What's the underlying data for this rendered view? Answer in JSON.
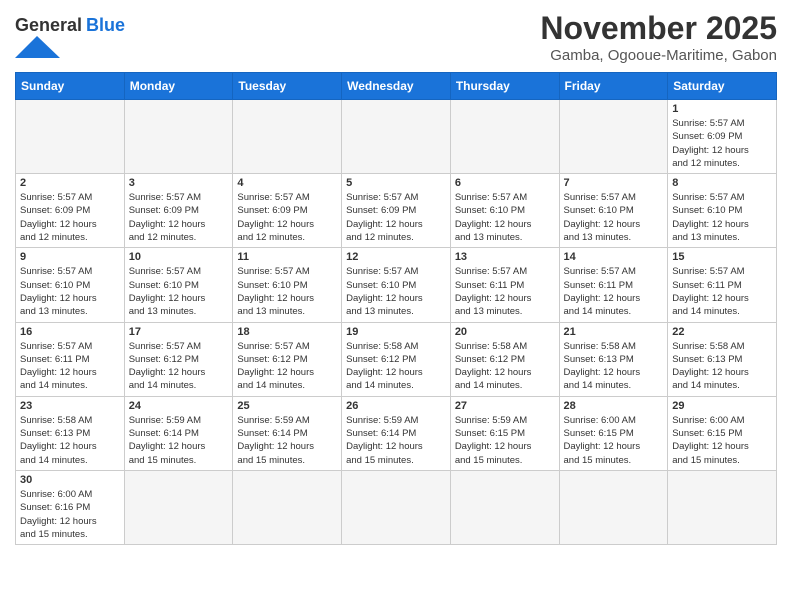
{
  "header": {
    "logo_general": "General",
    "logo_blue": "Blue",
    "month": "November 2025",
    "location": "Gamba, Ogooue-Maritime, Gabon"
  },
  "weekdays": [
    "Sunday",
    "Monday",
    "Tuesday",
    "Wednesday",
    "Thursday",
    "Friday",
    "Saturday"
  ],
  "days": [
    {
      "num": "",
      "empty": true,
      "info": ""
    },
    {
      "num": "",
      "empty": true,
      "info": ""
    },
    {
      "num": "",
      "empty": true,
      "info": ""
    },
    {
      "num": "",
      "empty": true,
      "info": ""
    },
    {
      "num": "",
      "empty": true,
      "info": ""
    },
    {
      "num": "",
      "empty": true,
      "info": ""
    },
    {
      "num": "1",
      "empty": false,
      "info": "Sunrise: 5:57 AM\nSunset: 6:09 PM\nDaylight: 12 hours\nand 12 minutes."
    },
    {
      "num": "2",
      "empty": false,
      "info": "Sunrise: 5:57 AM\nSunset: 6:09 PM\nDaylight: 12 hours\nand 12 minutes."
    },
    {
      "num": "3",
      "empty": false,
      "info": "Sunrise: 5:57 AM\nSunset: 6:09 PM\nDaylight: 12 hours\nand 12 minutes."
    },
    {
      "num": "4",
      "empty": false,
      "info": "Sunrise: 5:57 AM\nSunset: 6:09 PM\nDaylight: 12 hours\nand 12 minutes."
    },
    {
      "num": "5",
      "empty": false,
      "info": "Sunrise: 5:57 AM\nSunset: 6:09 PM\nDaylight: 12 hours\nand 12 minutes."
    },
    {
      "num": "6",
      "empty": false,
      "info": "Sunrise: 5:57 AM\nSunset: 6:10 PM\nDaylight: 12 hours\nand 13 minutes."
    },
    {
      "num": "7",
      "empty": false,
      "info": "Sunrise: 5:57 AM\nSunset: 6:10 PM\nDaylight: 12 hours\nand 13 minutes."
    },
    {
      "num": "8",
      "empty": false,
      "info": "Sunrise: 5:57 AM\nSunset: 6:10 PM\nDaylight: 12 hours\nand 13 minutes."
    },
    {
      "num": "9",
      "empty": false,
      "info": "Sunrise: 5:57 AM\nSunset: 6:10 PM\nDaylight: 12 hours\nand 13 minutes."
    },
    {
      "num": "10",
      "empty": false,
      "info": "Sunrise: 5:57 AM\nSunset: 6:10 PM\nDaylight: 12 hours\nand 13 minutes."
    },
    {
      "num": "11",
      "empty": false,
      "info": "Sunrise: 5:57 AM\nSunset: 6:10 PM\nDaylight: 12 hours\nand 13 minutes."
    },
    {
      "num": "12",
      "empty": false,
      "info": "Sunrise: 5:57 AM\nSunset: 6:10 PM\nDaylight: 12 hours\nand 13 minutes."
    },
    {
      "num": "13",
      "empty": false,
      "info": "Sunrise: 5:57 AM\nSunset: 6:11 PM\nDaylight: 12 hours\nand 13 minutes."
    },
    {
      "num": "14",
      "empty": false,
      "info": "Sunrise: 5:57 AM\nSunset: 6:11 PM\nDaylight: 12 hours\nand 14 minutes."
    },
    {
      "num": "15",
      "empty": false,
      "info": "Sunrise: 5:57 AM\nSunset: 6:11 PM\nDaylight: 12 hours\nand 14 minutes."
    },
    {
      "num": "16",
      "empty": false,
      "info": "Sunrise: 5:57 AM\nSunset: 6:11 PM\nDaylight: 12 hours\nand 14 minutes."
    },
    {
      "num": "17",
      "empty": false,
      "info": "Sunrise: 5:57 AM\nSunset: 6:12 PM\nDaylight: 12 hours\nand 14 minutes."
    },
    {
      "num": "18",
      "empty": false,
      "info": "Sunrise: 5:57 AM\nSunset: 6:12 PM\nDaylight: 12 hours\nand 14 minutes."
    },
    {
      "num": "19",
      "empty": false,
      "info": "Sunrise: 5:58 AM\nSunset: 6:12 PM\nDaylight: 12 hours\nand 14 minutes."
    },
    {
      "num": "20",
      "empty": false,
      "info": "Sunrise: 5:58 AM\nSunset: 6:12 PM\nDaylight: 12 hours\nand 14 minutes."
    },
    {
      "num": "21",
      "empty": false,
      "info": "Sunrise: 5:58 AM\nSunset: 6:13 PM\nDaylight: 12 hours\nand 14 minutes."
    },
    {
      "num": "22",
      "empty": false,
      "info": "Sunrise: 5:58 AM\nSunset: 6:13 PM\nDaylight: 12 hours\nand 14 minutes."
    },
    {
      "num": "23",
      "empty": false,
      "info": "Sunrise: 5:58 AM\nSunset: 6:13 PM\nDaylight: 12 hours\nand 14 minutes."
    },
    {
      "num": "24",
      "empty": false,
      "info": "Sunrise: 5:59 AM\nSunset: 6:14 PM\nDaylight: 12 hours\nand 15 minutes."
    },
    {
      "num": "25",
      "empty": false,
      "info": "Sunrise: 5:59 AM\nSunset: 6:14 PM\nDaylight: 12 hours\nand 15 minutes."
    },
    {
      "num": "26",
      "empty": false,
      "info": "Sunrise: 5:59 AM\nSunset: 6:14 PM\nDaylight: 12 hours\nand 15 minutes."
    },
    {
      "num": "27",
      "empty": false,
      "info": "Sunrise: 5:59 AM\nSunset: 6:15 PM\nDaylight: 12 hours\nand 15 minutes."
    },
    {
      "num": "28",
      "empty": false,
      "info": "Sunrise: 6:00 AM\nSunset: 6:15 PM\nDaylight: 12 hours\nand 15 minutes."
    },
    {
      "num": "29",
      "empty": false,
      "info": "Sunrise: 6:00 AM\nSunset: 6:15 PM\nDaylight: 12 hours\nand 15 minutes."
    },
    {
      "num": "30",
      "empty": false,
      "info": "Sunrise: 6:00 AM\nSunset: 6:16 PM\nDaylight: 12 hours\nand 15 minutes."
    },
    {
      "num": "",
      "empty": true,
      "info": ""
    },
    {
      "num": "",
      "empty": true,
      "info": ""
    },
    {
      "num": "",
      "empty": true,
      "info": ""
    },
    {
      "num": "",
      "empty": true,
      "info": ""
    },
    {
      "num": "",
      "empty": true,
      "info": ""
    },
    {
      "num": "",
      "empty": true,
      "info": ""
    }
  ]
}
